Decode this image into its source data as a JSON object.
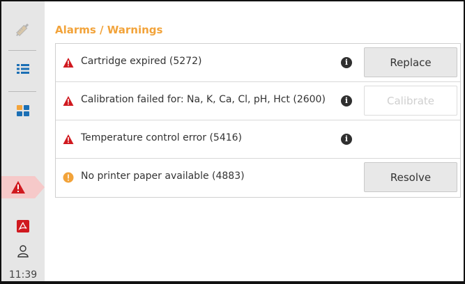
{
  "sidebar": {
    "items": [
      {
        "icon": "syringe-icon"
      },
      {
        "icon": "list-icon"
      },
      {
        "icon": "grid-icon"
      },
      {
        "icon": "alert-icon"
      },
      {
        "icon": "pdf-icon"
      },
      {
        "icon": "user-icon"
      }
    ],
    "time": "11:39"
  },
  "page": {
    "title": "Alarms / Warnings"
  },
  "alarms": [
    {
      "severity": "error",
      "message": "Cartridge expired (5272)",
      "info": "i",
      "action": "Replace",
      "action_enabled": true
    },
    {
      "severity": "error",
      "message": "Calibration failed for: Na, K, Ca, Cl, pH, Hct (2600)",
      "info": "i",
      "action": "Calibrate",
      "action_enabled": false
    },
    {
      "severity": "error",
      "message": "Temperature control error (5416)",
      "info": "i",
      "action": "",
      "action_enabled": false
    },
    {
      "severity": "warning",
      "message": "No printer paper available (4883)",
      "info": "",
      "action": "Resolve",
      "action_enabled": true
    }
  ],
  "colors": {
    "accent": "#f2a33a",
    "error": "#d0191f",
    "warning": "#f2a33a",
    "active_bg": "#f6c9c9"
  }
}
